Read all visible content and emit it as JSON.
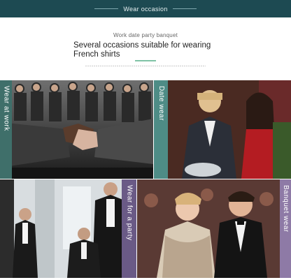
{
  "banner": {
    "title": "Wear occasion"
  },
  "intro": {
    "subline": "Work date party banquet",
    "headline": "Several occasions suitable for wearing French shirts"
  },
  "panels": [
    {
      "label": "Wear at work",
      "accent": "#3f6f6a"
    },
    {
      "label": "Date wear",
      "accent": "#4e8c86"
    },
    {
      "label": "Wear for a party",
      "accent": "#6a5a86"
    },
    {
      "label": "Banquet wear",
      "accent": "#8e7aa6"
    }
  ],
  "colors": {
    "banner_bg": "#1d4a52",
    "accent_line": "#7fc3a6"
  }
}
